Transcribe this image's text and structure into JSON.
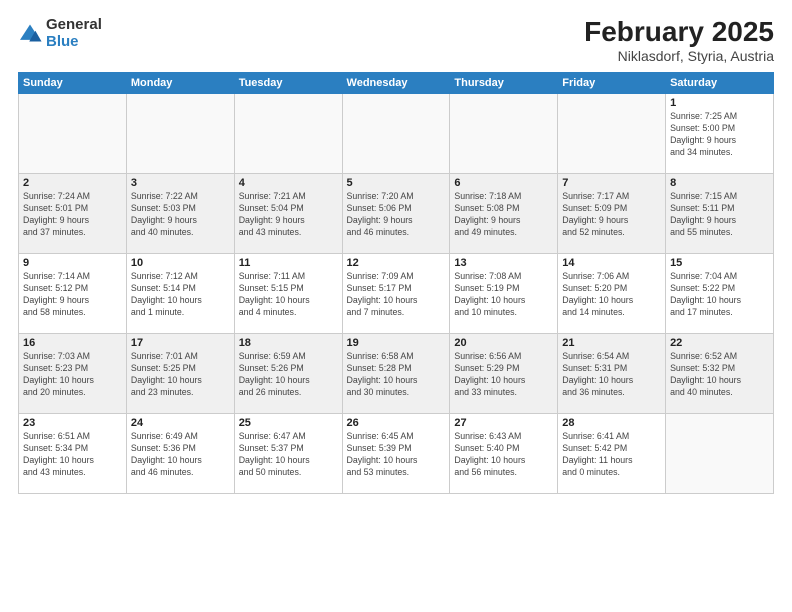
{
  "logo": {
    "text1": "General",
    "text2": "Blue"
  },
  "header": {
    "month": "February 2025",
    "location": "Niklasdorf, Styria, Austria"
  },
  "days_of_week": [
    "Sunday",
    "Monday",
    "Tuesday",
    "Wednesday",
    "Thursday",
    "Friday",
    "Saturday"
  ],
  "weeks": [
    {
      "alt": false,
      "days": [
        {
          "num": "",
          "info": ""
        },
        {
          "num": "",
          "info": ""
        },
        {
          "num": "",
          "info": ""
        },
        {
          "num": "",
          "info": ""
        },
        {
          "num": "",
          "info": ""
        },
        {
          "num": "",
          "info": ""
        },
        {
          "num": "1",
          "info": "Sunrise: 7:25 AM\nSunset: 5:00 PM\nDaylight: 9 hours\nand 34 minutes."
        }
      ]
    },
    {
      "alt": true,
      "days": [
        {
          "num": "2",
          "info": "Sunrise: 7:24 AM\nSunset: 5:01 PM\nDaylight: 9 hours\nand 37 minutes."
        },
        {
          "num": "3",
          "info": "Sunrise: 7:22 AM\nSunset: 5:03 PM\nDaylight: 9 hours\nand 40 minutes."
        },
        {
          "num": "4",
          "info": "Sunrise: 7:21 AM\nSunset: 5:04 PM\nDaylight: 9 hours\nand 43 minutes."
        },
        {
          "num": "5",
          "info": "Sunrise: 7:20 AM\nSunset: 5:06 PM\nDaylight: 9 hours\nand 46 minutes."
        },
        {
          "num": "6",
          "info": "Sunrise: 7:18 AM\nSunset: 5:08 PM\nDaylight: 9 hours\nand 49 minutes."
        },
        {
          "num": "7",
          "info": "Sunrise: 7:17 AM\nSunset: 5:09 PM\nDaylight: 9 hours\nand 52 minutes."
        },
        {
          "num": "8",
          "info": "Sunrise: 7:15 AM\nSunset: 5:11 PM\nDaylight: 9 hours\nand 55 minutes."
        }
      ]
    },
    {
      "alt": false,
      "days": [
        {
          "num": "9",
          "info": "Sunrise: 7:14 AM\nSunset: 5:12 PM\nDaylight: 9 hours\nand 58 minutes."
        },
        {
          "num": "10",
          "info": "Sunrise: 7:12 AM\nSunset: 5:14 PM\nDaylight: 10 hours\nand 1 minute."
        },
        {
          "num": "11",
          "info": "Sunrise: 7:11 AM\nSunset: 5:15 PM\nDaylight: 10 hours\nand 4 minutes."
        },
        {
          "num": "12",
          "info": "Sunrise: 7:09 AM\nSunset: 5:17 PM\nDaylight: 10 hours\nand 7 minutes."
        },
        {
          "num": "13",
          "info": "Sunrise: 7:08 AM\nSunset: 5:19 PM\nDaylight: 10 hours\nand 10 minutes."
        },
        {
          "num": "14",
          "info": "Sunrise: 7:06 AM\nSunset: 5:20 PM\nDaylight: 10 hours\nand 14 minutes."
        },
        {
          "num": "15",
          "info": "Sunrise: 7:04 AM\nSunset: 5:22 PM\nDaylight: 10 hours\nand 17 minutes."
        }
      ]
    },
    {
      "alt": true,
      "days": [
        {
          "num": "16",
          "info": "Sunrise: 7:03 AM\nSunset: 5:23 PM\nDaylight: 10 hours\nand 20 minutes."
        },
        {
          "num": "17",
          "info": "Sunrise: 7:01 AM\nSunset: 5:25 PM\nDaylight: 10 hours\nand 23 minutes."
        },
        {
          "num": "18",
          "info": "Sunrise: 6:59 AM\nSunset: 5:26 PM\nDaylight: 10 hours\nand 26 minutes."
        },
        {
          "num": "19",
          "info": "Sunrise: 6:58 AM\nSunset: 5:28 PM\nDaylight: 10 hours\nand 30 minutes."
        },
        {
          "num": "20",
          "info": "Sunrise: 6:56 AM\nSunset: 5:29 PM\nDaylight: 10 hours\nand 33 minutes."
        },
        {
          "num": "21",
          "info": "Sunrise: 6:54 AM\nSunset: 5:31 PM\nDaylight: 10 hours\nand 36 minutes."
        },
        {
          "num": "22",
          "info": "Sunrise: 6:52 AM\nSunset: 5:32 PM\nDaylight: 10 hours\nand 40 minutes."
        }
      ]
    },
    {
      "alt": false,
      "days": [
        {
          "num": "23",
          "info": "Sunrise: 6:51 AM\nSunset: 5:34 PM\nDaylight: 10 hours\nand 43 minutes."
        },
        {
          "num": "24",
          "info": "Sunrise: 6:49 AM\nSunset: 5:36 PM\nDaylight: 10 hours\nand 46 minutes."
        },
        {
          "num": "25",
          "info": "Sunrise: 6:47 AM\nSunset: 5:37 PM\nDaylight: 10 hours\nand 50 minutes."
        },
        {
          "num": "26",
          "info": "Sunrise: 6:45 AM\nSunset: 5:39 PM\nDaylight: 10 hours\nand 53 minutes."
        },
        {
          "num": "27",
          "info": "Sunrise: 6:43 AM\nSunset: 5:40 PM\nDaylight: 10 hours\nand 56 minutes."
        },
        {
          "num": "28",
          "info": "Sunrise: 6:41 AM\nSunset: 5:42 PM\nDaylight: 11 hours\nand 0 minutes."
        },
        {
          "num": "",
          "info": ""
        }
      ]
    }
  ]
}
